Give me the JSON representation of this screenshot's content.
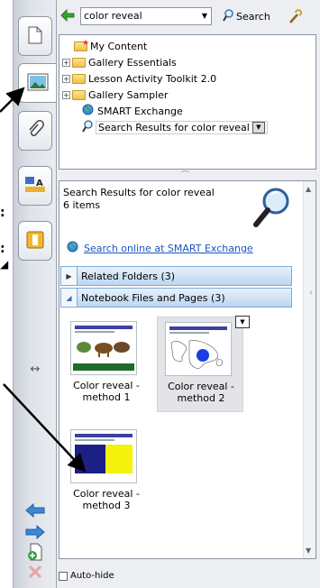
{
  "toolbar": {
    "back_icon": "back-arrow-icon",
    "search_value": "color reveal",
    "search_label": "Search",
    "settings_icon": "wrench-icon"
  },
  "tree": {
    "items": [
      {
        "label": "My Content",
        "icon": "my-content-folder-icon"
      },
      {
        "label": "Gallery Essentials",
        "icon": "folder-icon",
        "expandable": true
      },
      {
        "label": "Lesson Activity Toolkit 2.0",
        "icon": "folder-icon",
        "expandable": true
      },
      {
        "label": "Gallery Sampler",
        "icon": "folder-icon",
        "expandable": true
      },
      {
        "label": "SMART Exchange",
        "icon": "globe-icon"
      },
      {
        "label": "Search Results for color reveal",
        "icon": "search-icon"
      }
    ]
  },
  "results": {
    "title": "Search Results for color reveal",
    "count": "6 items",
    "online_link": "Search online at SMART Exchange",
    "sections": [
      {
        "label": "Related Folders (3)",
        "expanded": false
      },
      {
        "label": "Notebook Files and Pages (3)",
        "expanded": true
      }
    ],
    "files": [
      {
        "line1": "Color reveal -",
        "line2": "method 1"
      },
      {
        "line1": "Color reveal -",
        "line2": "method 2"
      },
      {
        "line1": "Color reveal -",
        "line2": "method 3"
      }
    ]
  },
  "footer": {
    "autohide_label": "Auto-hide"
  },
  "rail": {
    "tabs": [
      "page-sorter-icon",
      "gallery-icon",
      "attachments-icon",
      "properties-icon",
      "addons-icon"
    ],
    "resize_icon": "resize-icon",
    "buttons": [
      "move-left-icon",
      "move-right-icon",
      "add-page-icon",
      "close-icon"
    ]
  },
  "colors": {
    "accent": "#1a56c4",
    "accordion": "#bcd6f1",
    "selection": "#e3e4e7"
  }
}
